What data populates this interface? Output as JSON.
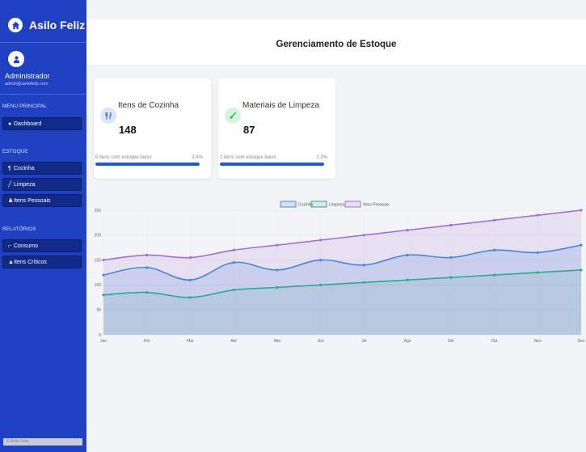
{
  "sidebar": {
    "brand": "Asilo Feliz",
    "user_name": "Administrador",
    "user_email": "admin@asilofeliz.com",
    "sections": {
      "menu": "MENU PRINCIPAL",
      "estoque": "ESTOQUE",
      "relatorios": "RELATÓRIOS"
    },
    "items": {
      "dashboard": "Dashboard",
      "cozinha": "Cozinha",
      "limpeza": "Limpeza",
      "pessoais": "Itens Pessoais",
      "consumo": "Consumo",
      "criticos": "Itens Críticos"
    },
    "footer": "© Asilo Feliz"
  },
  "header": {
    "title": "Gerenciamento de Estoque"
  },
  "cards": [
    {
      "title": "Itens de Cozinha",
      "value": "148",
      "note": "5 itens com estoque baixo",
      "pct": "3.4%",
      "icon": "utensils-icon",
      "icon_color": "#1f5bd6",
      "icon_bg": "#dbe7ff"
    },
    {
      "title": "Materiais de Limpeza",
      "value": "87",
      "note": "2 itens com estoque baixo",
      "pct": "2.3%",
      "icon": "brush-icon",
      "icon_color": "#16a34a",
      "icon_bg": "#d6f5df"
    }
  ],
  "chart_data": {
    "type": "area",
    "categories": [
      "Jan",
      "Fev",
      "Mar",
      "Abr",
      "Mai",
      "Jun",
      "Jul",
      "Ago",
      "Set",
      "Out",
      "Nov",
      "Dez"
    ],
    "y_ticks": [
      "0",
      "50",
      "100",
      "150",
      "200",
      "250"
    ],
    "ylim": [
      0,
      250
    ],
    "legend_position": "top",
    "series": [
      {
        "name": "Cozinha",
        "color": "#4a86d8",
        "values": [
          120,
          135,
          110,
          145,
          130,
          150,
          140,
          160,
          155,
          170,
          165,
          180
        ]
      },
      {
        "name": "Limpeza",
        "color": "#2fa88e",
        "values": [
          80,
          85,
          75,
          90,
          95,
          100,
          105,
          110,
          115,
          120,
          125,
          130
        ]
      },
      {
        "name": "Itens Pessoais",
        "color": "#a070d8",
        "values": [
          150,
          160,
          155,
          170,
          180,
          190,
          200,
          210,
          220,
          230,
          240,
          250
        ]
      }
    ]
  }
}
